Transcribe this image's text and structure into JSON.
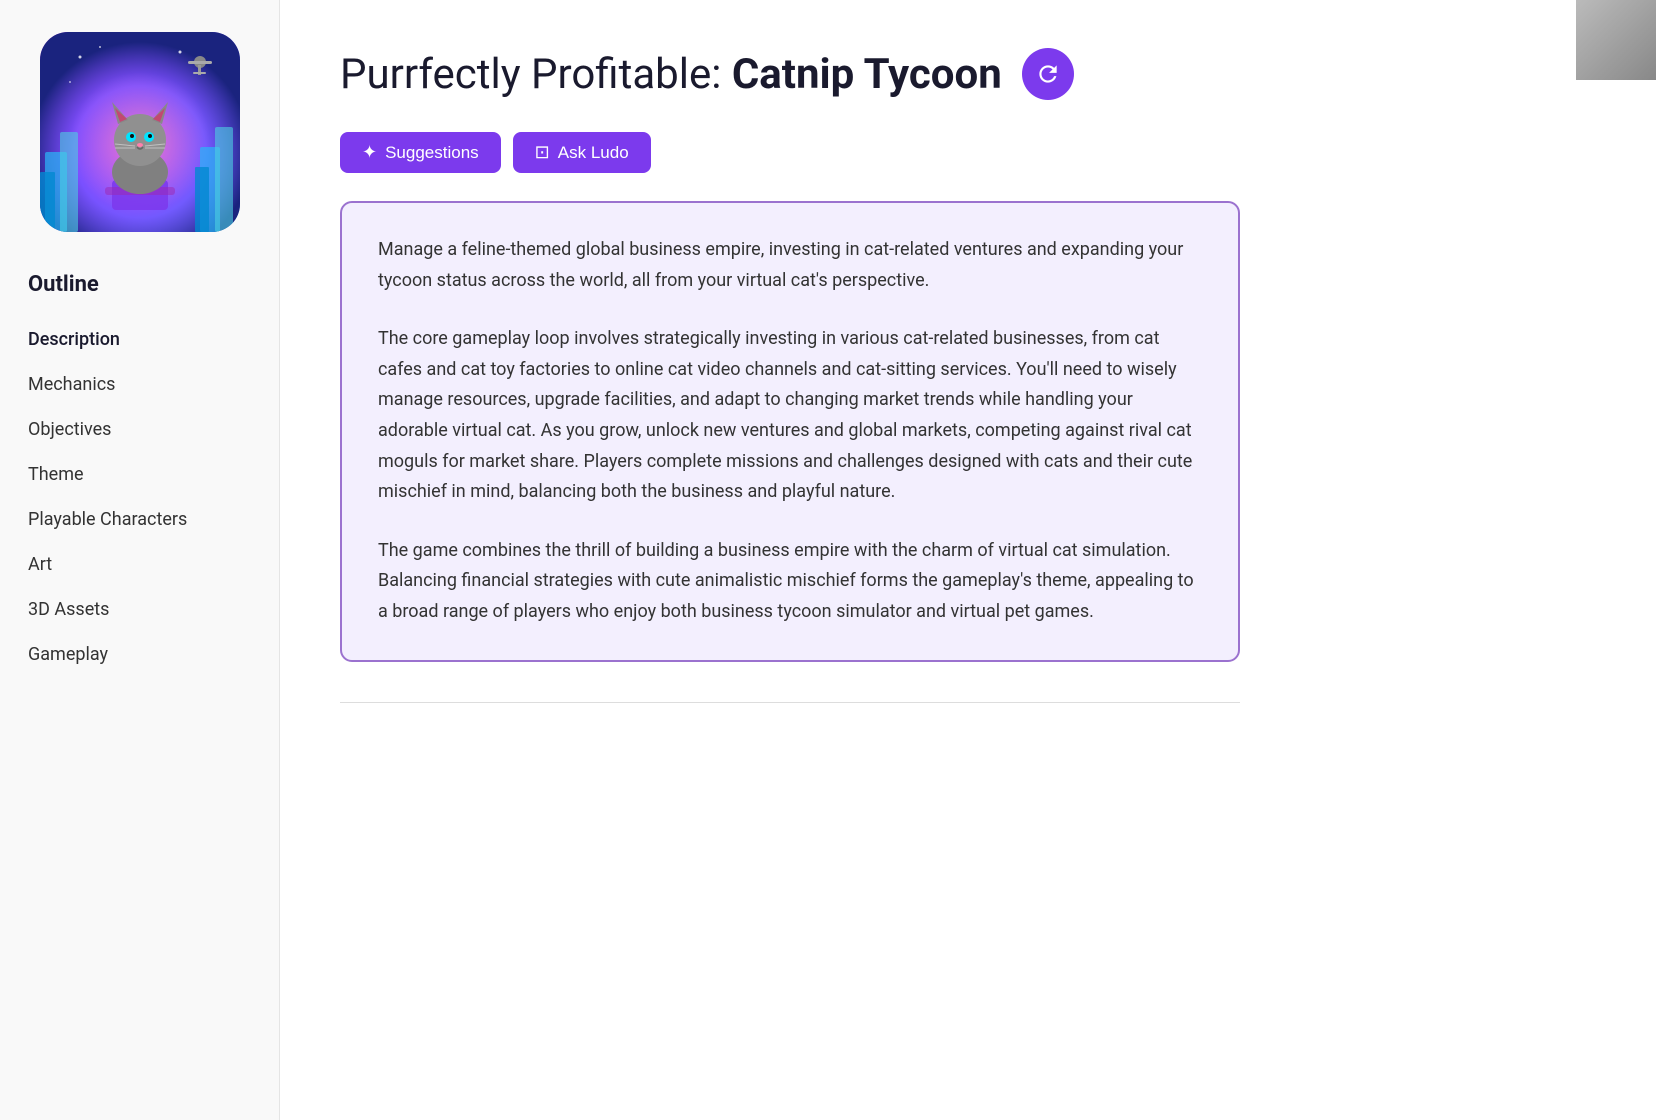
{
  "sidebar": {
    "outline_label": "Outline",
    "items": [
      {
        "id": "description",
        "label": "Description"
      },
      {
        "id": "mechanics",
        "label": "Mechanics"
      },
      {
        "id": "objectives",
        "label": "Objectives"
      },
      {
        "id": "theme",
        "label": "Theme"
      },
      {
        "id": "playable-characters",
        "label": "Playable Characters"
      },
      {
        "id": "art",
        "label": "Art"
      },
      {
        "id": "3d-assets",
        "label": "3D Assets"
      },
      {
        "id": "gameplay",
        "label": "Gameplay"
      }
    ]
  },
  "header": {
    "title_normal": "Purrfectly Profitable: ",
    "title_bold": "Catnip Tycoon",
    "refresh_label": "Refresh"
  },
  "buttons": {
    "suggestions_label": "Suggestions",
    "ask_ludo_label": "Ask Ludo"
  },
  "description": {
    "paragraph1": "Manage a feline-themed global business empire, investing in cat-related ventures and expanding your tycoon status across the world, all from your virtual cat's perspective.",
    "paragraph2": "The core gameplay loop involves strategically investing in various cat-related businesses, from cat cafes and cat toy factories to online cat video channels and cat-sitting services.  You'll need to wisely manage resources, upgrade facilities, and adapt to changing market trends while handling your adorable virtual cat. As you grow, unlock new ventures and global markets, competing against rival cat moguls for market share. Players complete missions and challenges designed with cats and their cute mischief in mind, balancing both the business and playful nature.",
    "paragraph3": "The game combines the thrill of building a business empire with the charm of virtual cat simulation. Balancing financial strategies with cute animalistic mischief forms the gameplay's theme, appealing to a broad range of players who enjoy both business tycoon simulator and virtual pet games."
  },
  "icons": {
    "suggestions_icon": "✦",
    "ask_ludo_icon": "⊡",
    "refresh_icon": "↻"
  }
}
